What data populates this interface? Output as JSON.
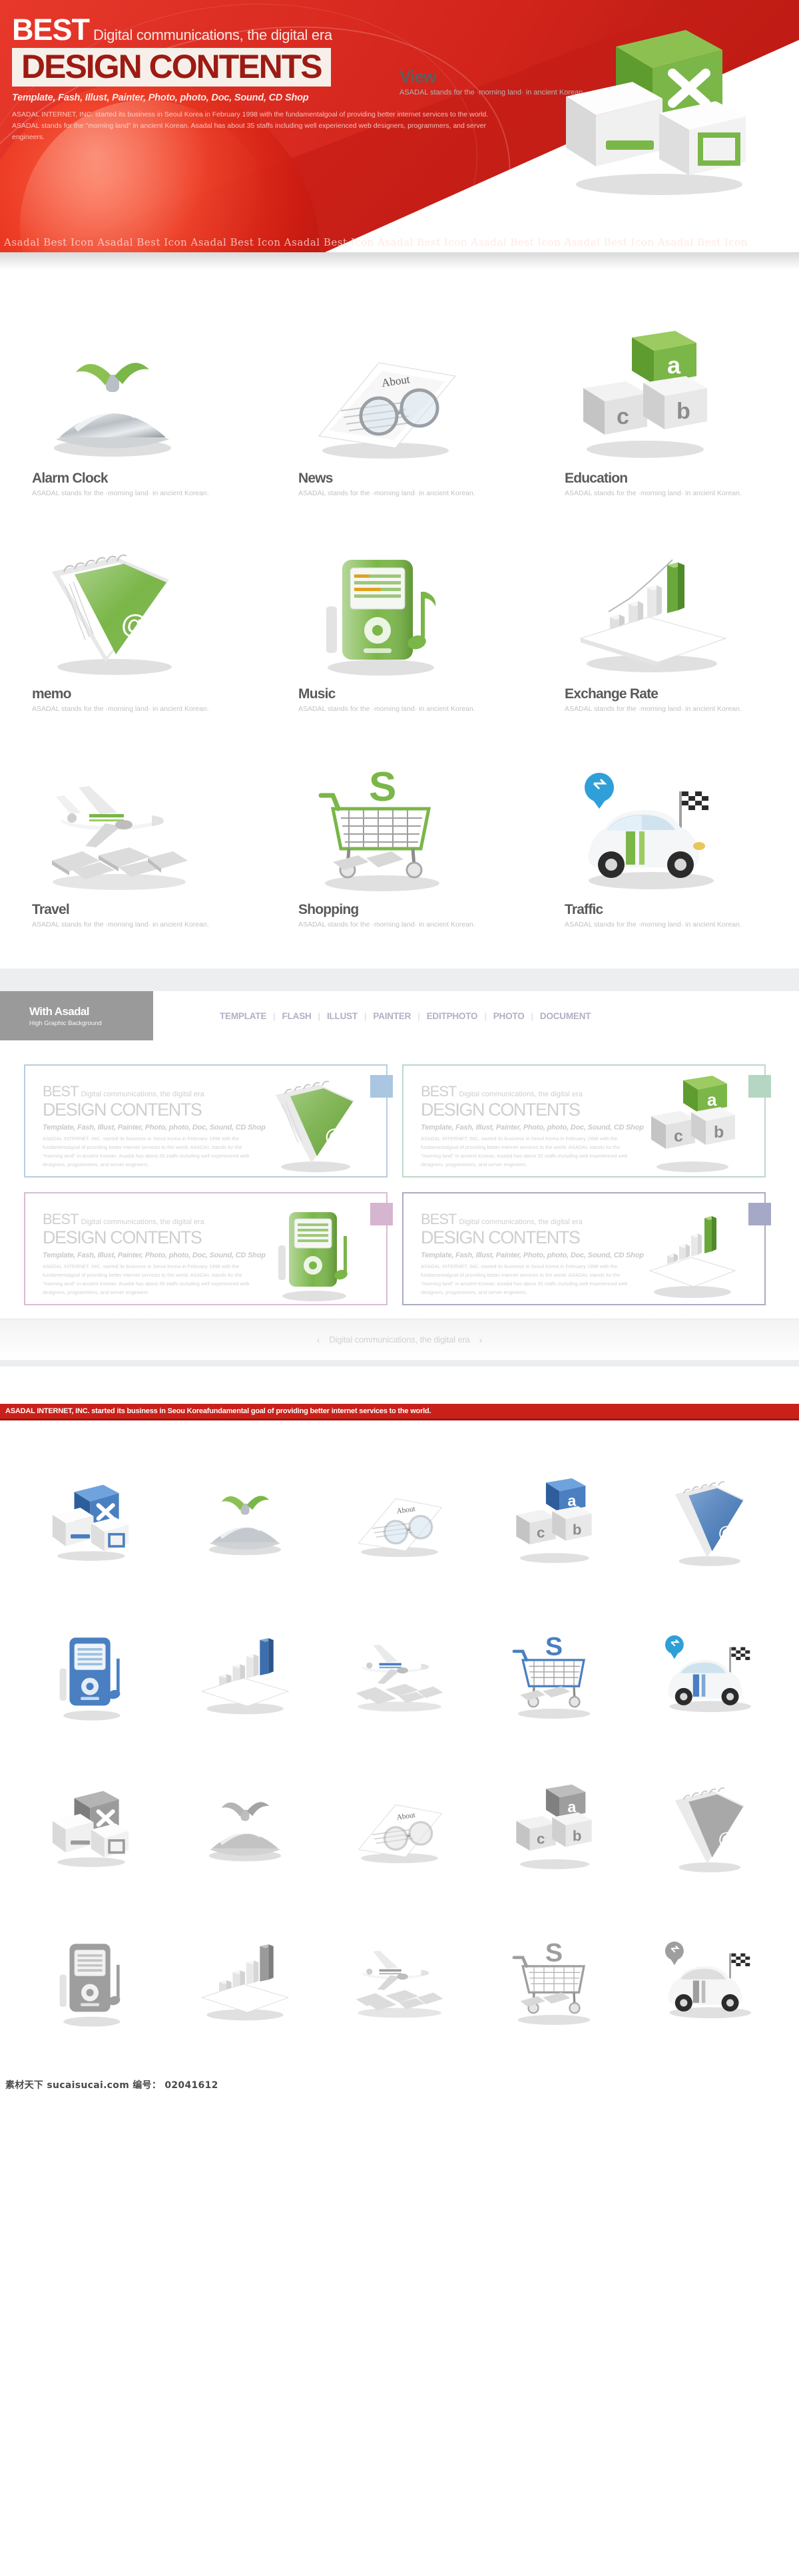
{
  "header": {
    "best": "BEST",
    "tagline": "Digital communications, the digital era",
    "title": "DESIGN CONTENTS",
    "subtitle": "Template, Fash, Illust, Painter, Photo, photo, Doc, Sound, CD Shop",
    "body": "ASADAL INTERNET, INC. started its business in Seoul Korea in February 1998 with the fundamentalgoal of providing better internet services to the world. ASADAL stands for the \"morning land\" in ancient Korean. Asadal has about 35 staffs including well experienced web designers, programmers, and server engineers.",
    "view_title": "View",
    "view_sub": "ASADAL stands for the ·morning land· in ancient Korean.",
    "marquee": "Asadal Best Icon  Asadal Best Icon  Asadal Best Icon  Asadal Best Icon  Asadal Best Icon  Asadal Best Icon  Asadal Best Icon  Asadal Best Icon"
  },
  "showcase": {
    "desc": "ASADAL stands for the ·morning land· in ancient Korean.",
    "items": [
      {
        "name": "Alarm Clock",
        "art": "cloche",
        "desc": "ASADAL stands for the ·morning land· in ancient Korean."
      },
      {
        "name": "News",
        "art": "news",
        "desc": "ASADAL stands for the ·morning land· in ancient Korean."
      },
      {
        "name": "Education",
        "art": "blocks",
        "desc": "ASADAL stands for the ·morning land· in ancient Korean."
      },
      {
        "name": "memo",
        "art": "notepad",
        "desc": "ASADAL stands for the ·morning land· in ancient Korean."
      },
      {
        "name": "Music",
        "art": "player",
        "desc": "ASADAL stands for the ·morning land· in ancient Korean."
      },
      {
        "name": "Exchange Rate",
        "art": "chart",
        "desc": "ASADAL stands for the ·morning land· in ancient Korean."
      },
      {
        "name": "Travel",
        "art": "plane",
        "desc": "ASADAL stands for the ·morning land· in ancient Korean."
      },
      {
        "name": "Shopping",
        "art": "cart",
        "desc": "ASADAL stands for the ·morning land· in ancient Korean."
      },
      {
        "name": "Traffic",
        "art": "car",
        "desc": "ASADAL stands for the ·morning land· in ancient Korean."
      }
    ]
  },
  "asadal": {
    "brand_title": "With Asadal",
    "brand_sub": "High Graphic Background",
    "nav": [
      "TEMPLATE",
      "FLASH",
      "ILLUST",
      "PAINTER",
      "EDITPHOTO",
      "PHOTO",
      "DOCUMENT"
    ],
    "nav_separator": "|"
  },
  "cards": [
    {
      "best": "BEST",
      "tag": "Digital communications, the digital era",
      "title": "DESIGN CONTENTS",
      "sub": "Template, Fash, Illust, Painter, Photo, photo, Doc, Sound, CD Shop",
      "body": "ASADAL INTERNET, INC. started its business in Seoul Korea in February 1998 with the fundamentalgoal of providing better internet services to the world. ASADAL stands for the \"morning land\" in ancient Korean. Asadal has about 35 staffs including well experienced web designers, programmers, and server engineers.",
      "art": "notepad",
      "accent": "#b9cde0"
    },
    {
      "best": "BEST",
      "tag": "Digital communications, the digital era",
      "title": "DESIGN CONTENTS",
      "sub": "Template, Fash, Illust, Painter, Photo, photo, Doc, Sound, CD Shop",
      "body": "ASADAL INTERNET, INC. started its business in Seoul Korea in February 1998 with the fundamentalgoal of providing better internet services to the world. ASADAL stands for the \"morning land\" in ancient Korean. Asadal has about 35 staffs including well experienced web designers, programmers, and server engineers.",
      "art": "blocks",
      "accent": "#bcd9c9"
    },
    {
      "best": "BEST",
      "tag": "Digital communications, the digital era",
      "title": "DESIGN CONTENTS",
      "sub": "Template, Fash, Illust, Painter, Photo, photo, Doc, Sound, CD Shop",
      "body": "ASADAL INTERNET, INC. started its business in Seoul Korea in February 1998 with the fundamentalgoal of providing better internet services to the world. ASADAL stands for the \"morning land\" in ancient Korean. Asadal has about 35 staffs including well experienced web designers, programmers, and server engineers.",
      "art": "player",
      "accent": "#d9bcd3"
    },
    {
      "best": "BEST",
      "tag": "Digital communications, the digital era",
      "title": "DESIGN CONTENTS",
      "sub": "Template, Fash, Illust, Painter, Photo, photo, Doc, Sound, CD Shop",
      "body": "ASADAL INTERNET, INC. started its business in Seoul Korea in February 1998 with the fundamentalgoal of providing better internet services to the world. ASADAL stands for the \"morning land\" in ancient Korean. Asadal has about 35 staffs including well experienced web designers, programmers, and server engineers.",
      "art": "chart",
      "accent": "#a9abc6"
    }
  ],
  "pager": {
    "prev": "‹",
    "next": "›",
    "text": "Digital communications, the digital era"
  },
  "notice": {
    "text": "ASADAL INTERNET, INC. started its business in Seou Koreafundamental goal of providing better internet services to the world."
  },
  "sprite_grid": {
    "rows": [
      [
        {
          "art": "hero",
          "tone": "blue"
        },
        {
          "art": "cloche",
          "tone": "green"
        },
        {
          "art": "news",
          "tone": "green"
        },
        {
          "art": "blocks",
          "tone": "blue"
        },
        {
          "art": "notepad",
          "tone": "blue"
        }
      ],
      [
        {
          "art": "player",
          "tone": "blue"
        },
        {
          "art": "chart",
          "tone": "blue"
        },
        {
          "art": "plane",
          "tone": "blue"
        },
        {
          "art": "cart",
          "tone": "blue"
        },
        {
          "art": "car",
          "tone": "blue"
        }
      ],
      [
        {
          "art": "hero",
          "tone": "gray"
        },
        {
          "art": "cloche",
          "tone": "gray"
        },
        {
          "art": "news",
          "tone": "gray"
        },
        {
          "art": "blocks",
          "tone": "gray"
        },
        {
          "art": "notepad",
          "tone": "gray"
        }
      ],
      [
        {
          "art": "player",
          "tone": "gray"
        },
        {
          "art": "chart",
          "tone": "gray"
        },
        {
          "art": "plane",
          "tone": "gray"
        },
        {
          "art": "cart",
          "tone": "gray"
        },
        {
          "art": "car",
          "tone": "gray"
        }
      ]
    ]
  },
  "watermark": {
    "text": "素材天下 sucaisucai.com  编号： 02041612"
  },
  "colors": {
    "brand_red": "#c9211a",
    "header_red": "#d2241b",
    "green": "#7ab648",
    "blue": "#4a7fc1",
    "gray": "#8d8d8d",
    "nav_purple": "#b4aec4"
  }
}
